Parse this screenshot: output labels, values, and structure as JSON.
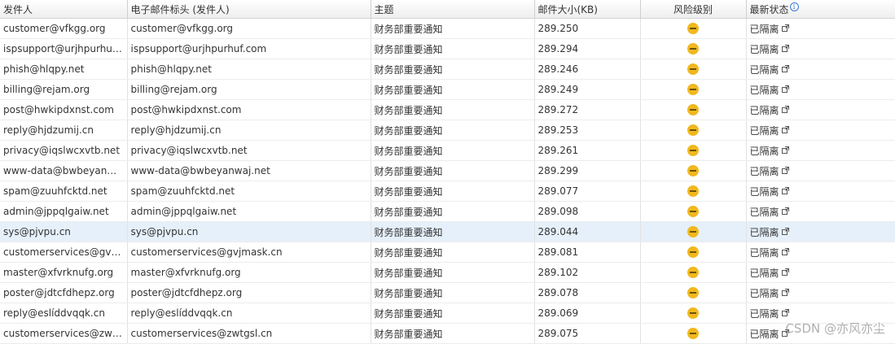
{
  "columns": {
    "sender": "发件人",
    "header_sender": "电子邮件标头 (发件人)",
    "subject": "主题",
    "size": "邮件大小(KB)",
    "risk": "风险级别",
    "status": "最新状态"
  },
  "icons": {
    "risk": "minus-circle-icon",
    "status_info": "info-icon",
    "status_link": "external-link-icon"
  },
  "colors": {
    "risk_medium": "#f1b81e",
    "selected_row": "#e6f0fa",
    "info_icon": "#3a7bd5"
  },
  "rows": [
    {
      "sender": "customer@vfkgg.org",
      "header_sender": "customer@vfkgg.org",
      "subject": "财务部重要通知",
      "size": "289.250",
      "status": "已隔离"
    },
    {
      "sender": "ispsupport@urjhpurhuf.c...",
      "header_sender": "ispsupport@urjhpurhuf.com",
      "subject": "财务部重要通知",
      "size": "289.294",
      "status": "已隔离"
    },
    {
      "sender": "phish@hlqpy.net",
      "header_sender": "phish@hlqpy.net",
      "subject": "财务部重要通知",
      "size": "289.246",
      "status": "已隔离"
    },
    {
      "sender": "billing@rejam.org",
      "header_sender": "billing@rejam.org",
      "subject": "财务部重要通知",
      "size": "289.249",
      "status": "已隔离"
    },
    {
      "sender": "post@hwkipdxnst.com",
      "header_sender": "post@hwkipdxnst.com",
      "subject": "财务部重要通知",
      "size": "289.272",
      "status": "已隔离"
    },
    {
      "sender": "reply@hjdzumij.cn",
      "header_sender": "reply@hjdzumij.cn",
      "subject": "财务部重要通知",
      "size": "289.253",
      "status": "已隔离"
    },
    {
      "sender": "privacy@iqslwcxvtb.net",
      "header_sender": "privacy@iqslwcxvtb.net",
      "subject": "财务部重要通知",
      "size": "289.261",
      "status": "已隔离"
    },
    {
      "sender": "www-data@bwbeyanwaj....",
      "header_sender": "www-data@bwbeyanwaj.net",
      "subject": "财务部重要通知",
      "size": "289.299",
      "status": "已隔离"
    },
    {
      "sender": "spam@zuuhfcktd.net",
      "header_sender": "spam@zuuhfcktd.net",
      "subject": "财务部重要通知",
      "size": "289.077",
      "status": "已隔离"
    },
    {
      "sender": "admin@jppqlgaiw.net",
      "header_sender": "admin@jppqlgaiw.net",
      "subject": "财务部重要通知",
      "size": "289.098",
      "status": "已隔离"
    },
    {
      "sender": "sys@pjvpu.cn",
      "header_sender": "sys@pjvpu.cn",
      "subject": "财务部重要通知",
      "size": "289.044",
      "status": "已隔离",
      "selected": true
    },
    {
      "sender": "customerservices@gvjm...",
      "header_sender": "customerservices@gvjmask.cn",
      "subject": "财务部重要通知",
      "size": "289.081",
      "status": "已隔离"
    },
    {
      "sender": "master@xfvrknufg.org",
      "header_sender": "master@xfvrknufg.org",
      "subject": "财务部重要通知",
      "size": "289.102",
      "status": "已隔离"
    },
    {
      "sender": "poster@jdtcfdhepz.org",
      "header_sender": "poster@jdtcfdhepz.org",
      "subject": "财务部重要通知",
      "size": "289.078",
      "status": "已隔离"
    },
    {
      "sender": "reply@eslíddvqqk.cn",
      "header_sender": "reply@eslíddvqqk.cn",
      "subject": "财务部重要通知",
      "size": "289.069",
      "status": "已隔离"
    },
    {
      "sender": "customerservices@zwtg...",
      "header_sender": "customerservices@zwtgsl.cn",
      "subject": "财务部重要通知",
      "size": "289.075",
      "status": "已隔离"
    }
  ],
  "watermark": "CSDN @亦风亦尘"
}
